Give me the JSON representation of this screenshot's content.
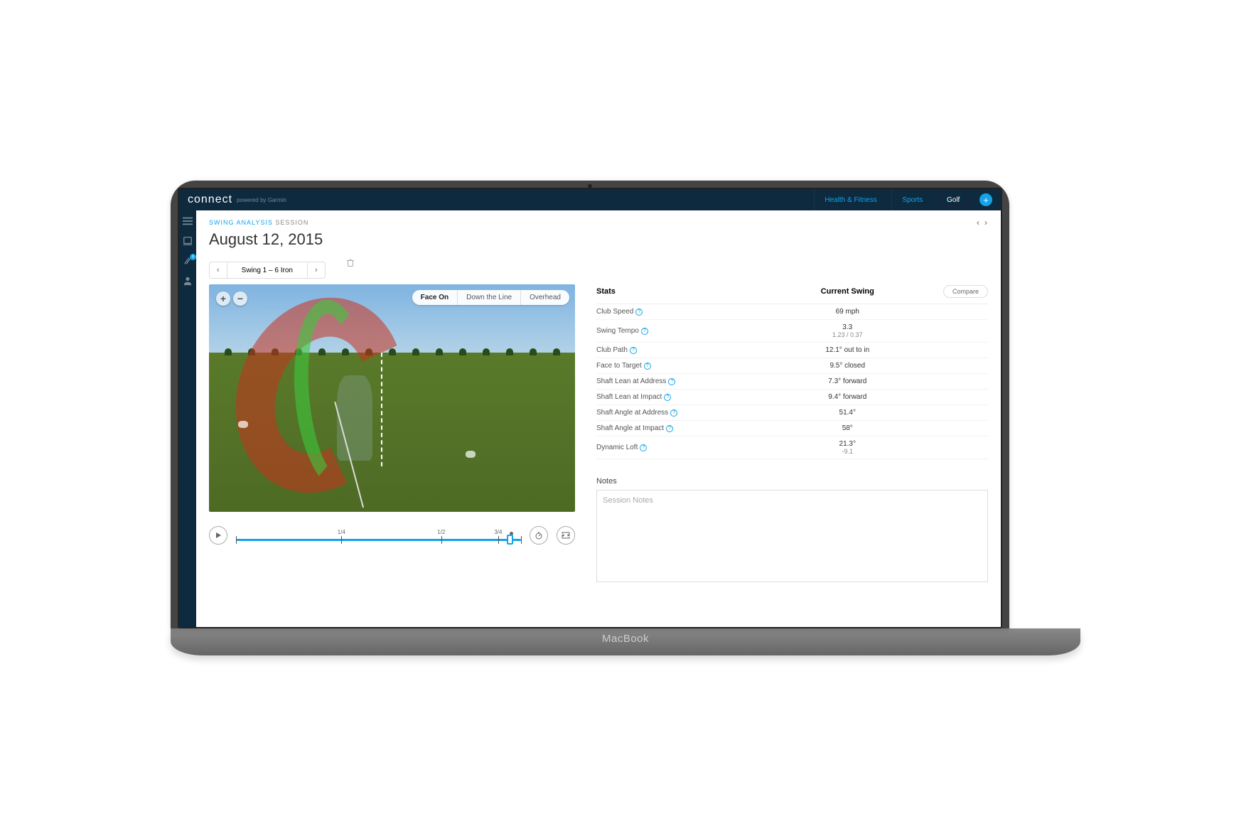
{
  "brand": {
    "name": "connect",
    "tagline": "powered by Garmin",
    "laptop": "MacBook"
  },
  "topnav": {
    "health": "Health & Fitness",
    "sports": "Sports",
    "golf": "Golf"
  },
  "sidebar": {
    "badge": "0"
  },
  "breadcrumb": {
    "cat": "SWING ANALYSIS",
    "sess": " SESSION"
  },
  "title": "August 12, 2015",
  "swing_nav": {
    "label": "Swing 1 – 6 Iron"
  },
  "view_tabs": {
    "face": "Face On",
    "down": "Down the Line",
    "over": "Overhead"
  },
  "timeline": {
    "ticks": [
      "1/4",
      "1/2",
      "3/4"
    ]
  },
  "stats": {
    "header": {
      "stats": "Stats",
      "current": "Current Swing",
      "compare": "Compare"
    },
    "rows": [
      {
        "label": "Club Speed",
        "value": "69 mph",
        "sub": ""
      },
      {
        "label": "Swing Tempo",
        "value": "3.3",
        "sub": "1.23 / 0.37"
      },
      {
        "label": "Club Path",
        "value": "12.1° out to in",
        "sub": ""
      },
      {
        "label": "Face to Target",
        "value": "9.5° closed",
        "sub": ""
      },
      {
        "label": "Shaft Lean at Address",
        "value": "7.3° forward",
        "sub": ""
      },
      {
        "label": "Shaft Lean at Impact",
        "value": "9.4° forward",
        "sub": ""
      },
      {
        "label": "Shaft Angle at Address",
        "value": "51.4°",
        "sub": ""
      },
      {
        "label": "Shaft Angle at Impact",
        "value": "58°",
        "sub": ""
      },
      {
        "label": "Dynamic Loft",
        "value": "21.3°",
        "sub": "-9.1"
      }
    ]
  },
  "notes": {
    "label": "Notes",
    "placeholder": "Session Notes"
  }
}
